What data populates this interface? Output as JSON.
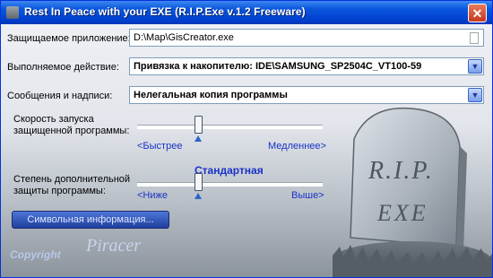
{
  "window": {
    "title": "Rest In Peace with your EXE (R.I.P.Exe v.1.2 Freeware)",
    "close_glyph": "✕"
  },
  "protected_app": {
    "label": "Защищаемое приложение:",
    "value": "D:\\Map\\GisCreator.exe"
  },
  "action": {
    "label": "Выполняемое действие:",
    "value": "Привязка к накопителю: IDE\\SAMSUNG_SP2504C_VT100-59"
  },
  "messages": {
    "label": "Сообщения и надписи:",
    "value": "Нелегальная копия программы"
  },
  "speed": {
    "label_line1": "Скорость запуска",
    "label_line2": "защищенной программы:",
    "left_label": "<Быстрее",
    "right_label": "Медленнее>",
    "level": 0.33
  },
  "protection": {
    "label_line1": "Степень дополнительной",
    "label_line2": "защиты программы:",
    "current": "Стандартная",
    "left_label": "<Ниже",
    "right_label": "Выше>",
    "level": 0.33
  },
  "symbol_button": {
    "label": "Символьная информация..."
  },
  "branding": {
    "copyright": "Copyright",
    "signature": "Piracer",
    "tombstone_line1": "R.I.P.",
    "tombstone_line2": "EXE"
  },
  "icons": {
    "app": "app-icon",
    "browse": "document-icon",
    "dropdown": "chevron-down-icon"
  },
  "colors": {
    "titlebar": "#0a56dd",
    "accent_text": "#1a32c8"
  }
}
